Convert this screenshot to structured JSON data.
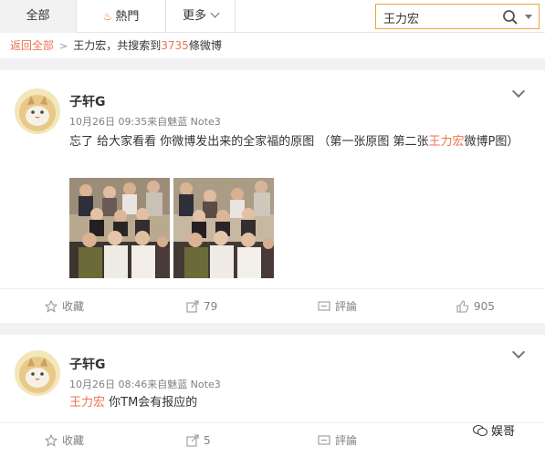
{
  "tabs": {
    "all": "全部",
    "hot": "熱門",
    "more": "更多"
  },
  "search": {
    "value": "王力宏"
  },
  "breadcrumb": {
    "back": "返回全部",
    "name": "王力宏",
    "text1": "，共搜索到",
    "count": "3735",
    "text2": "條微博"
  },
  "posts": [
    {
      "user": "子轩G",
      "meta": "10月26日 09:35来自魅蓝 Note3",
      "text_a": "忘了 给大家看看 你微博发出来的全家福的原图 （第一张原图 第二张",
      "text_hl": "王力宏",
      "text_b": "微博P图）",
      "actions": {
        "fav": "收藏",
        "repost": "79",
        "comment": "評論",
        "like": "905"
      }
    },
    {
      "user": "子轩G",
      "meta": "10月26日 08:46来自魅蓝 Note3",
      "text_hl": "王力宏",
      "text_b": " 你TM会有报应的",
      "actions": {
        "fav": "收藏",
        "repost": "5",
        "comment": "評論"
      }
    }
  ],
  "watermark": "娱哥",
  "colors": {
    "accent": "#eb7350",
    "search_border": "#f0a040",
    "fire": "#f07828"
  }
}
